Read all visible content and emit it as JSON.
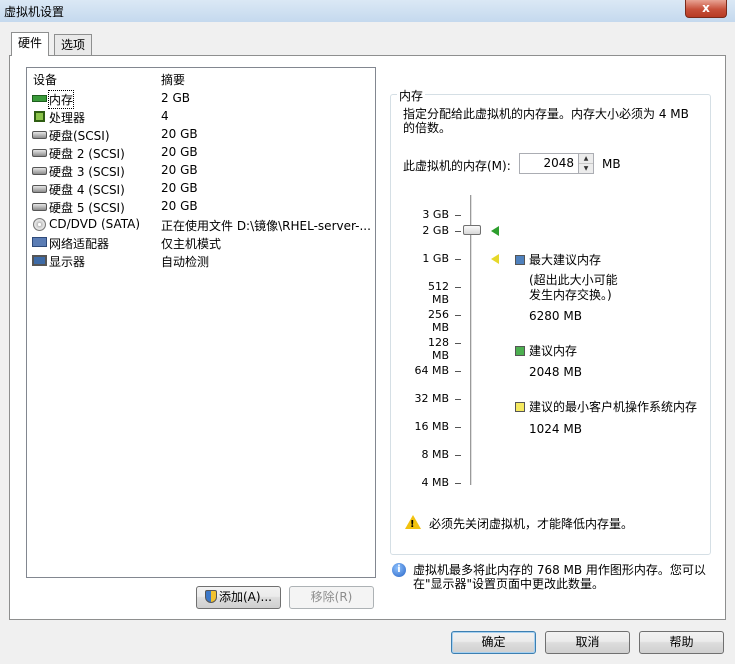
{
  "window": {
    "title": "虚拟机设置",
    "close_label": "x"
  },
  "tabs": [
    {
      "label": "硬件"
    },
    {
      "label": "选项"
    }
  ],
  "device_list": {
    "headers": {
      "device": "设备",
      "summary": "摘要"
    },
    "rows": [
      {
        "name": "内存",
        "summary": "2 GB",
        "icon": "memory-icon"
      },
      {
        "name": "处理器",
        "summary": "4",
        "icon": "processor-icon"
      },
      {
        "name": "硬盘(SCSI)",
        "summary": "20 GB",
        "icon": "hard-disk-icon"
      },
      {
        "name": "硬盘 2 (SCSI)",
        "summary": "20 GB",
        "icon": "hard-disk-icon"
      },
      {
        "name": "硬盘 3 (SCSI)",
        "summary": "20 GB",
        "icon": "hard-disk-icon"
      },
      {
        "name": "硬盘 4 (SCSI)",
        "summary": "20 GB",
        "icon": "hard-disk-icon"
      },
      {
        "name": "硬盘 5 (SCSI)",
        "summary": "20 GB",
        "icon": "hard-disk-icon"
      },
      {
        "name": "CD/DVD (SATA)",
        "summary": "正在使用文件 D:\\镜像\\RHEL-server-...",
        "icon": "cd-dvd-icon"
      },
      {
        "name": "网络适配器",
        "summary": "仅主机模式",
        "icon": "network-adapter-icon"
      },
      {
        "name": "显示器",
        "summary": "自动检测",
        "icon": "display-icon"
      }
    ]
  },
  "buttons": {
    "add": "添加(A)...",
    "remove": "移除(R)",
    "ok": "确定",
    "cancel": "取消",
    "help": "帮助"
  },
  "memory": {
    "group_title": "内存",
    "description": "指定分配给此虚拟机的内存量。内存大小必须为 4 MB 的倍数。",
    "field_label": "此虚拟机的内存(M):",
    "field_value": "2048",
    "field_unit": "MB",
    "slider_ticks": [
      "3 GB",
      "2 GB",
      "1 GB",
      "512 MB",
      "256 MB",
      "128 MB",
      "64 MB",
      "32 MB",
      "16 MB",
      "8 MB",
      "4 MB"
    ],
    "legend": {
      "max": {
        "title": "最大建议内存",
        "note_line1": "(超出此大小可能",
        "note_line2": "发生内存交换。)",
        "value": "6280 MB",
        "color": "#4f81bd"
      },
      "recommended": {
        "title": "建议内存",
        "value": "2048 MB",
        "color": "#4caf50"
      },
      "minimum": {
        "title": "建议的最小客户机操作系统内存",
        "value": "1024 MB",
        "color": "#f5e960"
      }
    },
    "warning": "必须先关闭虚拟机，才能降低内存量。"
  },
  "info_note": "虚拟机最多将此内存的 768 MB 用作图形内存。您可以在\"显示器\"设置页面中更改此数量。"
}
